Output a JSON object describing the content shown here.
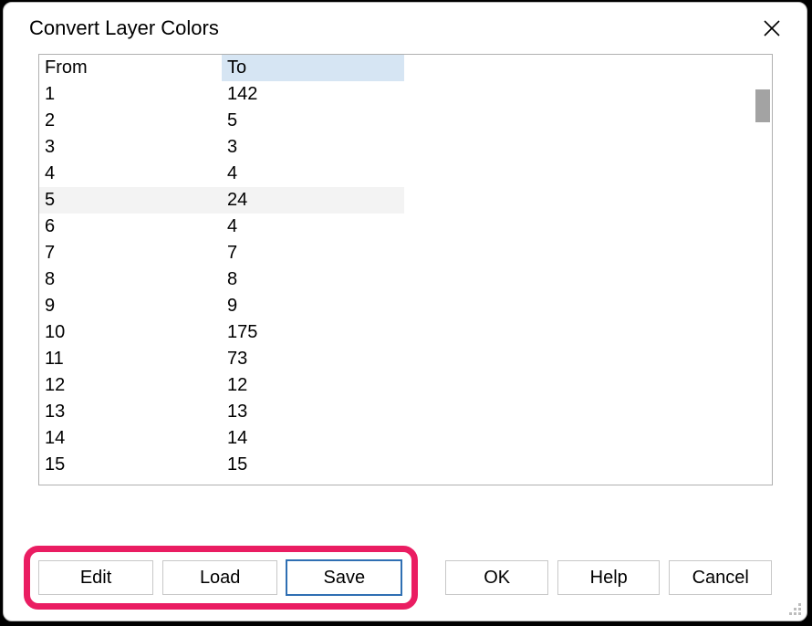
{
  "dialog": {
    "title": "Convert Layer Colors"
  },
  "table": {
    "headers": {
      "from": "From",
      "to": "To"
    },
    "selected_column": "to",
    "striped_row_index": 4,
    "rows": [
      {
        "from": "1",
        "to": "142"
      },
      {
        "from": "2",
        "to": "5"
      },
      {
        "from": "3",
        "to": "3"
      },
      {
        "from": "4",
        "to": "4"
      },
      {
        "from": "5",
        "to": "24"
      },
      {
        "from": "6",
        "to": "4"
      },
      {
        "from": "7",
        "to": "7"
      },
      {
        "from": "8",
        "to": "8"
      },
      {
        "from": "9",
        "to": "9"
      },
      {
        "from": "10",
        "to": "175"
      },
      {
        "from": "11",
        "to": "73"
      },
      {
        "from": "12",
        "to": "12"
      },
      {
        "from": "13",
        "to": "13"
      },
      {
        "from": "14",
        "to": "14"
      },
      {
        "from": "15",
        "to": "15"
      }
    ]
  },
  "buttons": {
    "edit": "Edit",
    "load": "Load",
    "save": "Save",
    "ok": "OK",
    "help": "Help",
    "cancel": "Cancel"
  },
  "annotation": {
    "highlight_buttons": [
      "edit",
      "load",
      "save"
    ],
    "color": "#ea1d62"
  }
}
